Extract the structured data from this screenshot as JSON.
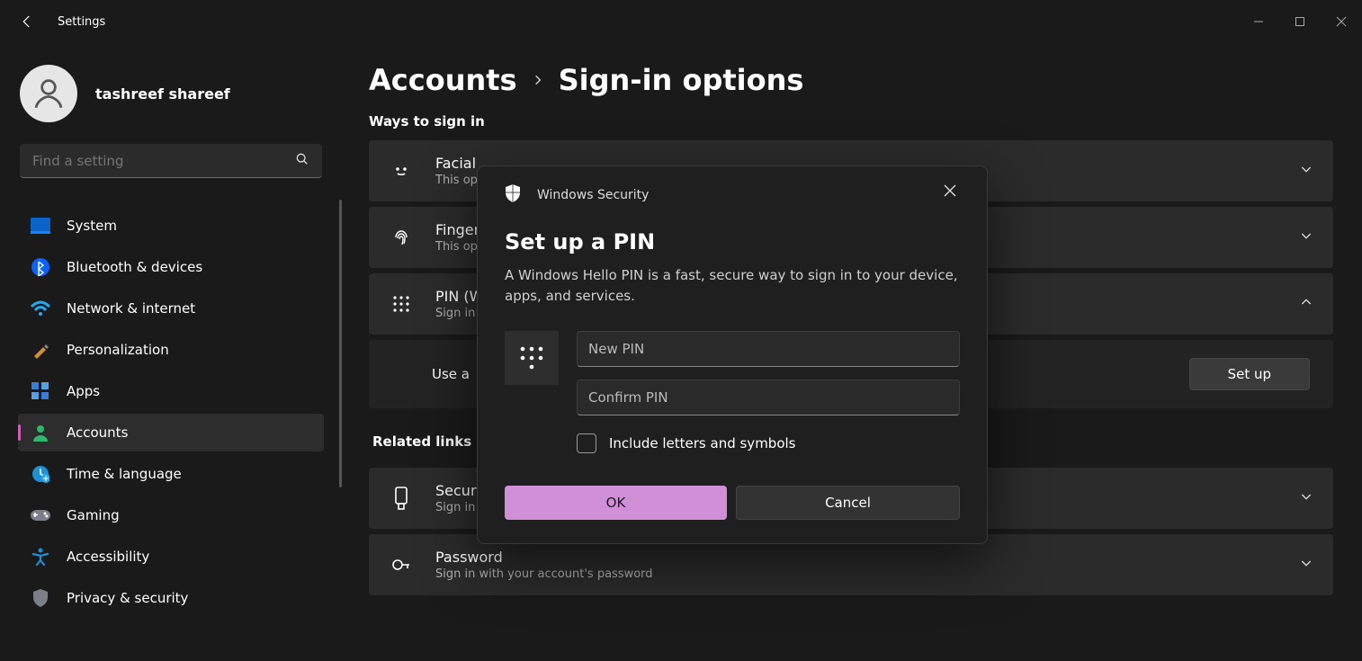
{
  "titlebar": {
    "title": "Settings"
  },
  "user": {
    "name": "tashreef shareef"
  },
  "search": {
    "placeholder": "Find a setting"
  },
  "nav": {
    "items": [
      {
        "label": "System"
      },
      {
        "label": "Bluetooth & devices"
      },
      {
        "label": "Network & internet"
      },
      {
        "label": "Personalization"
      },
      {
        "label": "Apps"
      },
      {
        "label": "Accounts"
      },
      {
        "label": "Time & language"
      },
      {
        "label": "Gaming"
      },
      {
        "label": "Accessibility"
      },
      {
        "label": "Privacy & security"
      }
    ]
  },
  "breadcrumb": {
    "parent": "Accounts",
    "current": "Sign-in options"
  },
  "section": {
    "ways": "Ways to sign in",
    "related": "Related links"
  },
  "cards": {
    "facial": {
      "title": "Facial",
      "sub": "This op"
    },
    "finger": {
      "title": "Finger",
      "sub": "This op"
    },
    "pin": {
      "title": "PIN (W",
      "sub": "Sign in"
    },
    "use": {
      "label": "Use a",
      "button": "Set up"
    },
    "security": {
      "title": "Securi",
      "sub": "Sign in"
    },
    "password": {
      "title": "Password",
      "sub": "Sign in with your account's password"
    }
  },
  "dialog": {
    "app": "Windows Security",
    "title": "Set up a PIN",
    "desc": "A Windows Hello PIN is a fast, secure way to sign in to your device, apps, and services.",
    "new_pin_placeholder": "New PIN",
    "confirm_pin_placeholder": "Confirm PIN",
    "checkbox_label": "Include letters and symbols",
    "ok": "OK",
    "cancel": "Cancel"
  }
}
